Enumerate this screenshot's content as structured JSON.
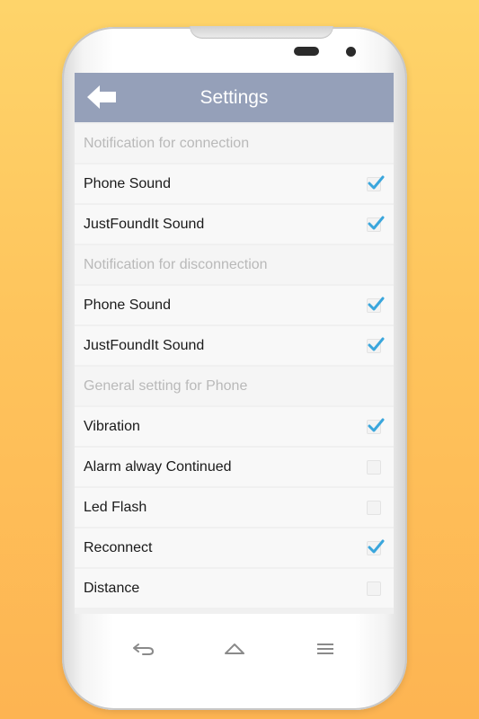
{
  "app": {
    "title": "Settings"
  },
  "settings": [
    {
      "type": "header",
      "label": "Notification for connection"
    },
    {
      "type": "item",
      "label": "Phone Sound",
      "checked": true
    },
    {
      "type": "item",
      "label": "JustFoundIt Sound",
      "checked": true
    },
    {
      "type": "header",
      "label": "Notification for disconnection"
    },
    {
      "type": "item",
      "label": "Phone Sound",
      "checked": true
    },
    {
      "type": "item",
      "label": "JustFoundIt Sound",
      "checked": true
    },
    {
      "type": "header",
      "label": "General setting for Phone"
    },
    {
      "type": "item",
      "label": "Vibration",
      "checked": true
    },
    {
      "type": "item",
      "label": "Alarm alway Continued",
      "checked": false
    },
    {
      "type": "item",
      "label": "Led Flash",
      "checked": false
    },
    {
      "type": "item",
      "label": "Reconnect",
      "checked": true
    },
    {
      "type": "item",
      "label": "Distance",
      "checked": false
    }
  ],
  "icons": {
    "back": "back-arrow-icon",
    "check": "checkmark-icon",
    "nav_back": "return-arrow-icon",
    "nav_home": "home-icon",
    "nav_menu": "menu-icon"
  },
  "colors": {
    "appbar": "#95a0b9",
    "check": "#3aa6dc",
    "background_top": "#fed46a",
    "background_bottom": "#fdb452"
  }
}
